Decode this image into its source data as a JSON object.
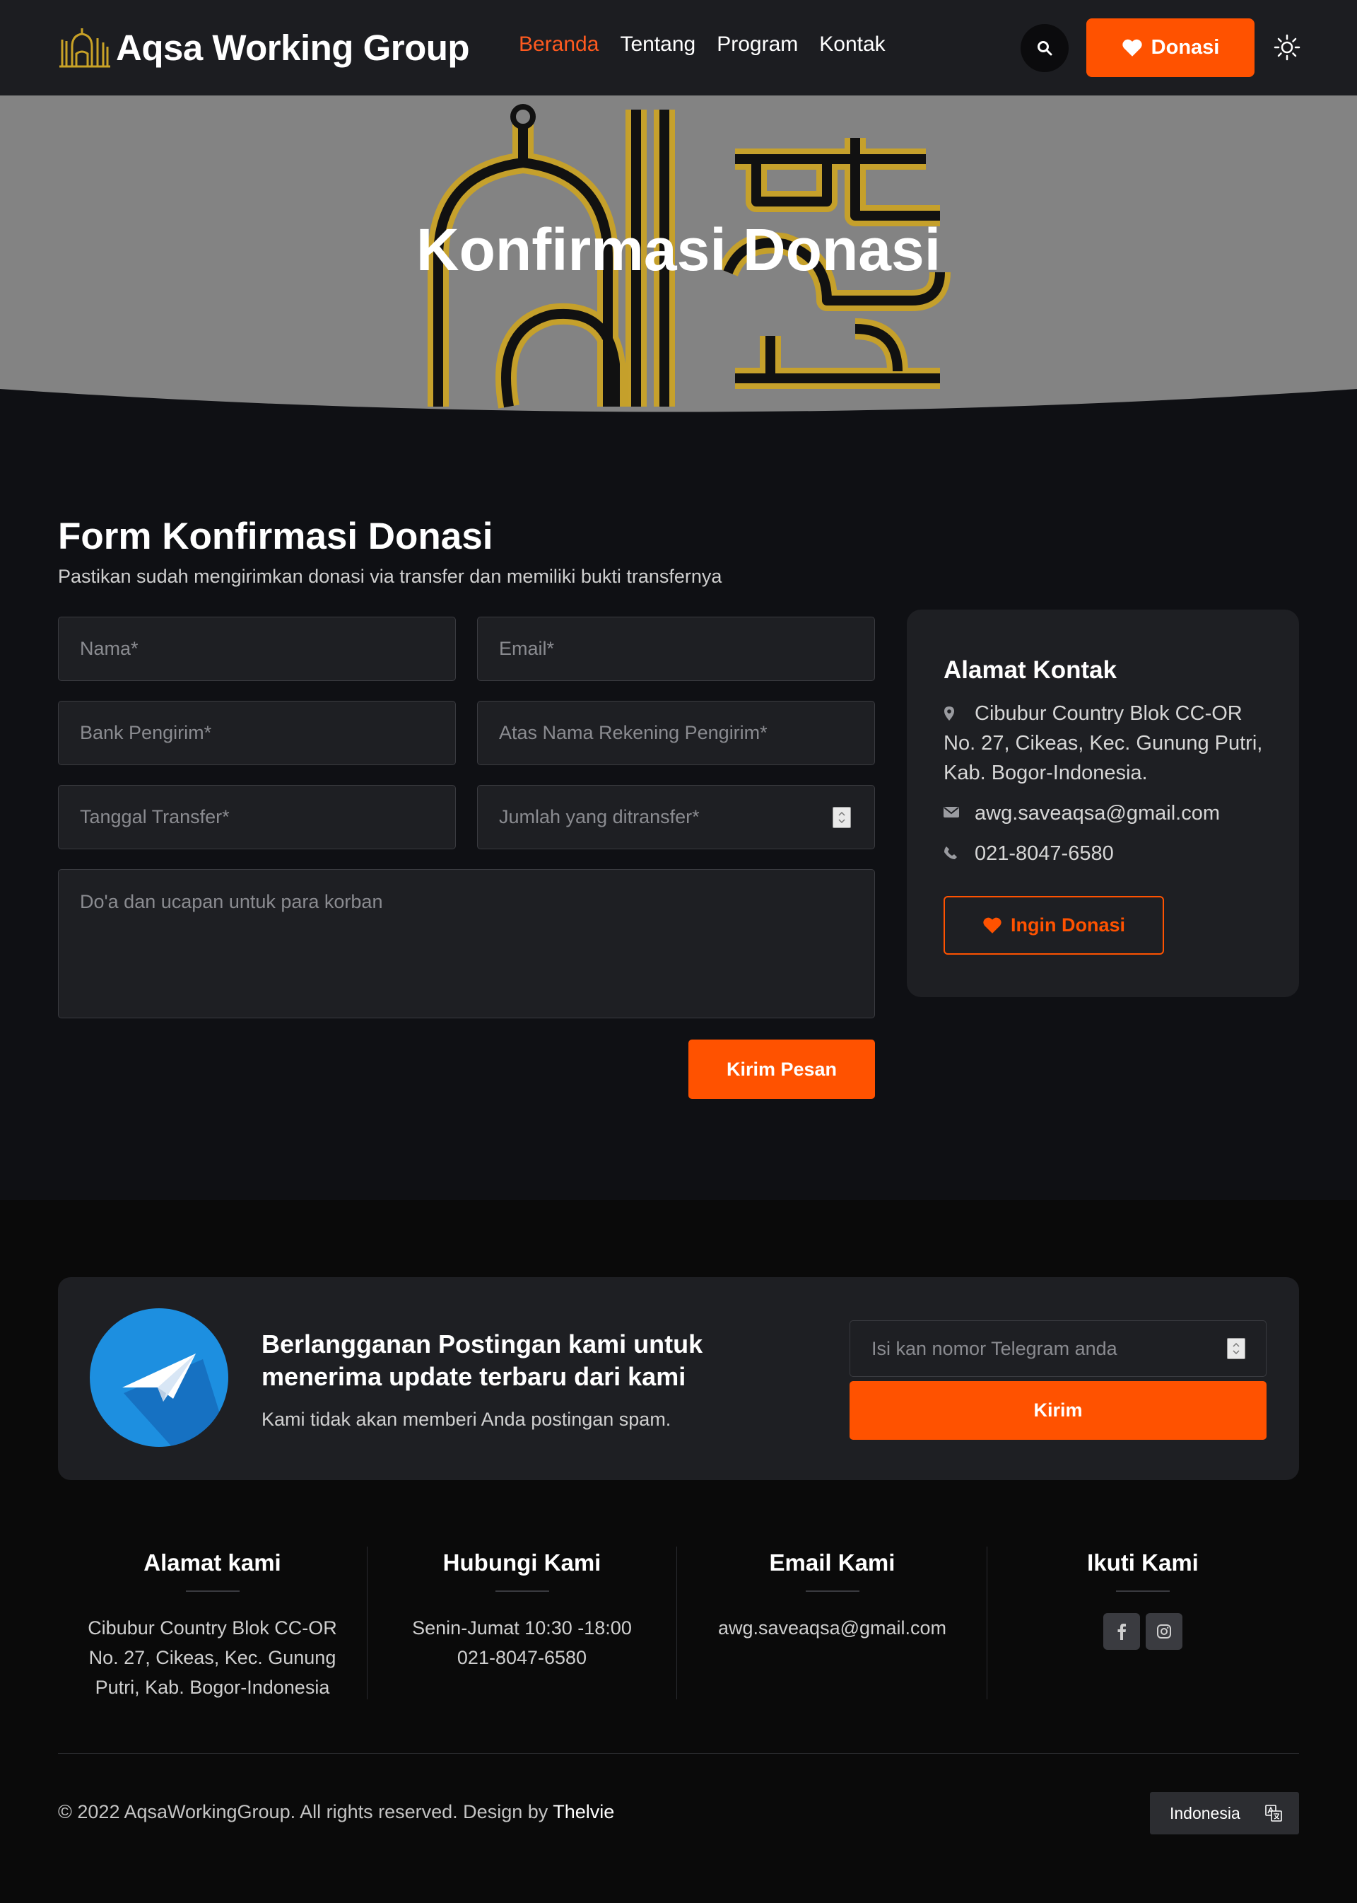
{
  "brand": {
    "name": "Aqsa Working Group"
  },
  "nav": {
    "items": [
      {
        "label": "Beranda",
        "active": true
      },
      {
        "label": "Tentang",
        "active": false
      },
      {
        "label": "Program",
        "active": false
      },
      {
        "label": "Kontak",
        "active": false
      }
    ],
    "donate_label": "Donasi"
  },
  "hero": {
    "title": "Konfirmasi Donasi"
  },
  "form": {
    "title": "Form Konfirmasi Donasi",
    "subtitle": "Pastikan sudah mengirimkan donasi via transfer dan memiliki bukti transfernya",
    "fields": {
      "name": "Nama*",
      "email": "Email*",
      "bank": "Bank Pengirim*",
      "account_name": "Atas Nama Rekening Pengirim*",
      "date": "Tanggal Transfer*",
      "amount": "Jumlah yang ditransfer*",
      "message": "Do'a dan ucapan untuk para korban"
    },
    "submit_label": "Kirim Pesan"
  },
  "contact": {
    "title": "Alamat Kontak",
    "address": "Cibubur Country Blok CC-OR No. 27, Cikeas, Kec. Gunung Putri, Kab. Bogor-Indonesia.",
    "email": "awg.saveaqsa@gmail.com",
    "phone": "021-8047-6580",
    "donate_label": "Ingin Donasi"
  },
  "subscribe": {
    "title": "Berlangganan Postingan kami untuk menerima update terbaru dari kami",
    "text": "Kami tidak akan memberi Anda postingan spam.",
    "placeholder": "Isi kan nomor Telegram anda",
    "button": "Kirim"
  },
  "footer": {
    "columns": [
      {
        "title": "Alamat kami",
        "lines": [
          "Cibubur Country Blok CC-OR",
          "No. 27, Cikeas, Kec. Gunung",
          "Putri, Kab. Bogor-Indonesia"
        ]
      },
      {
        "title": "Hubungi Kami",
        "lines": [
          "Senin-Jumat 10:30 -18:00",
          "021-8047-6580"
        ]
      },
      {
        "title": "Email Kami",
        "lines": [
          "awg.saveaqsa@gmail.com"
        ]
      },
      {
        "title": "Ikuti Kami",
        "socials": [
          "facebook-icon",
          "instagram-icon"
        ]
      }
    ],
    "copyright_prefix": "© 2022 AqsaWorkingGroup. All rights reserved. Design by",
    "copyright_link": "Thelvie",
    "language": "Indonesia"
  },
  "colors": {
    "accent": "#ff5200",
    "nav_bg": "#1c1d21",
    "page_bg": "#0f1014",
    "card_bg": "#1e1f23",
    "footer_bg": "#0a0a0a",
    "telegram": "#1d8fe0"
  }
}
